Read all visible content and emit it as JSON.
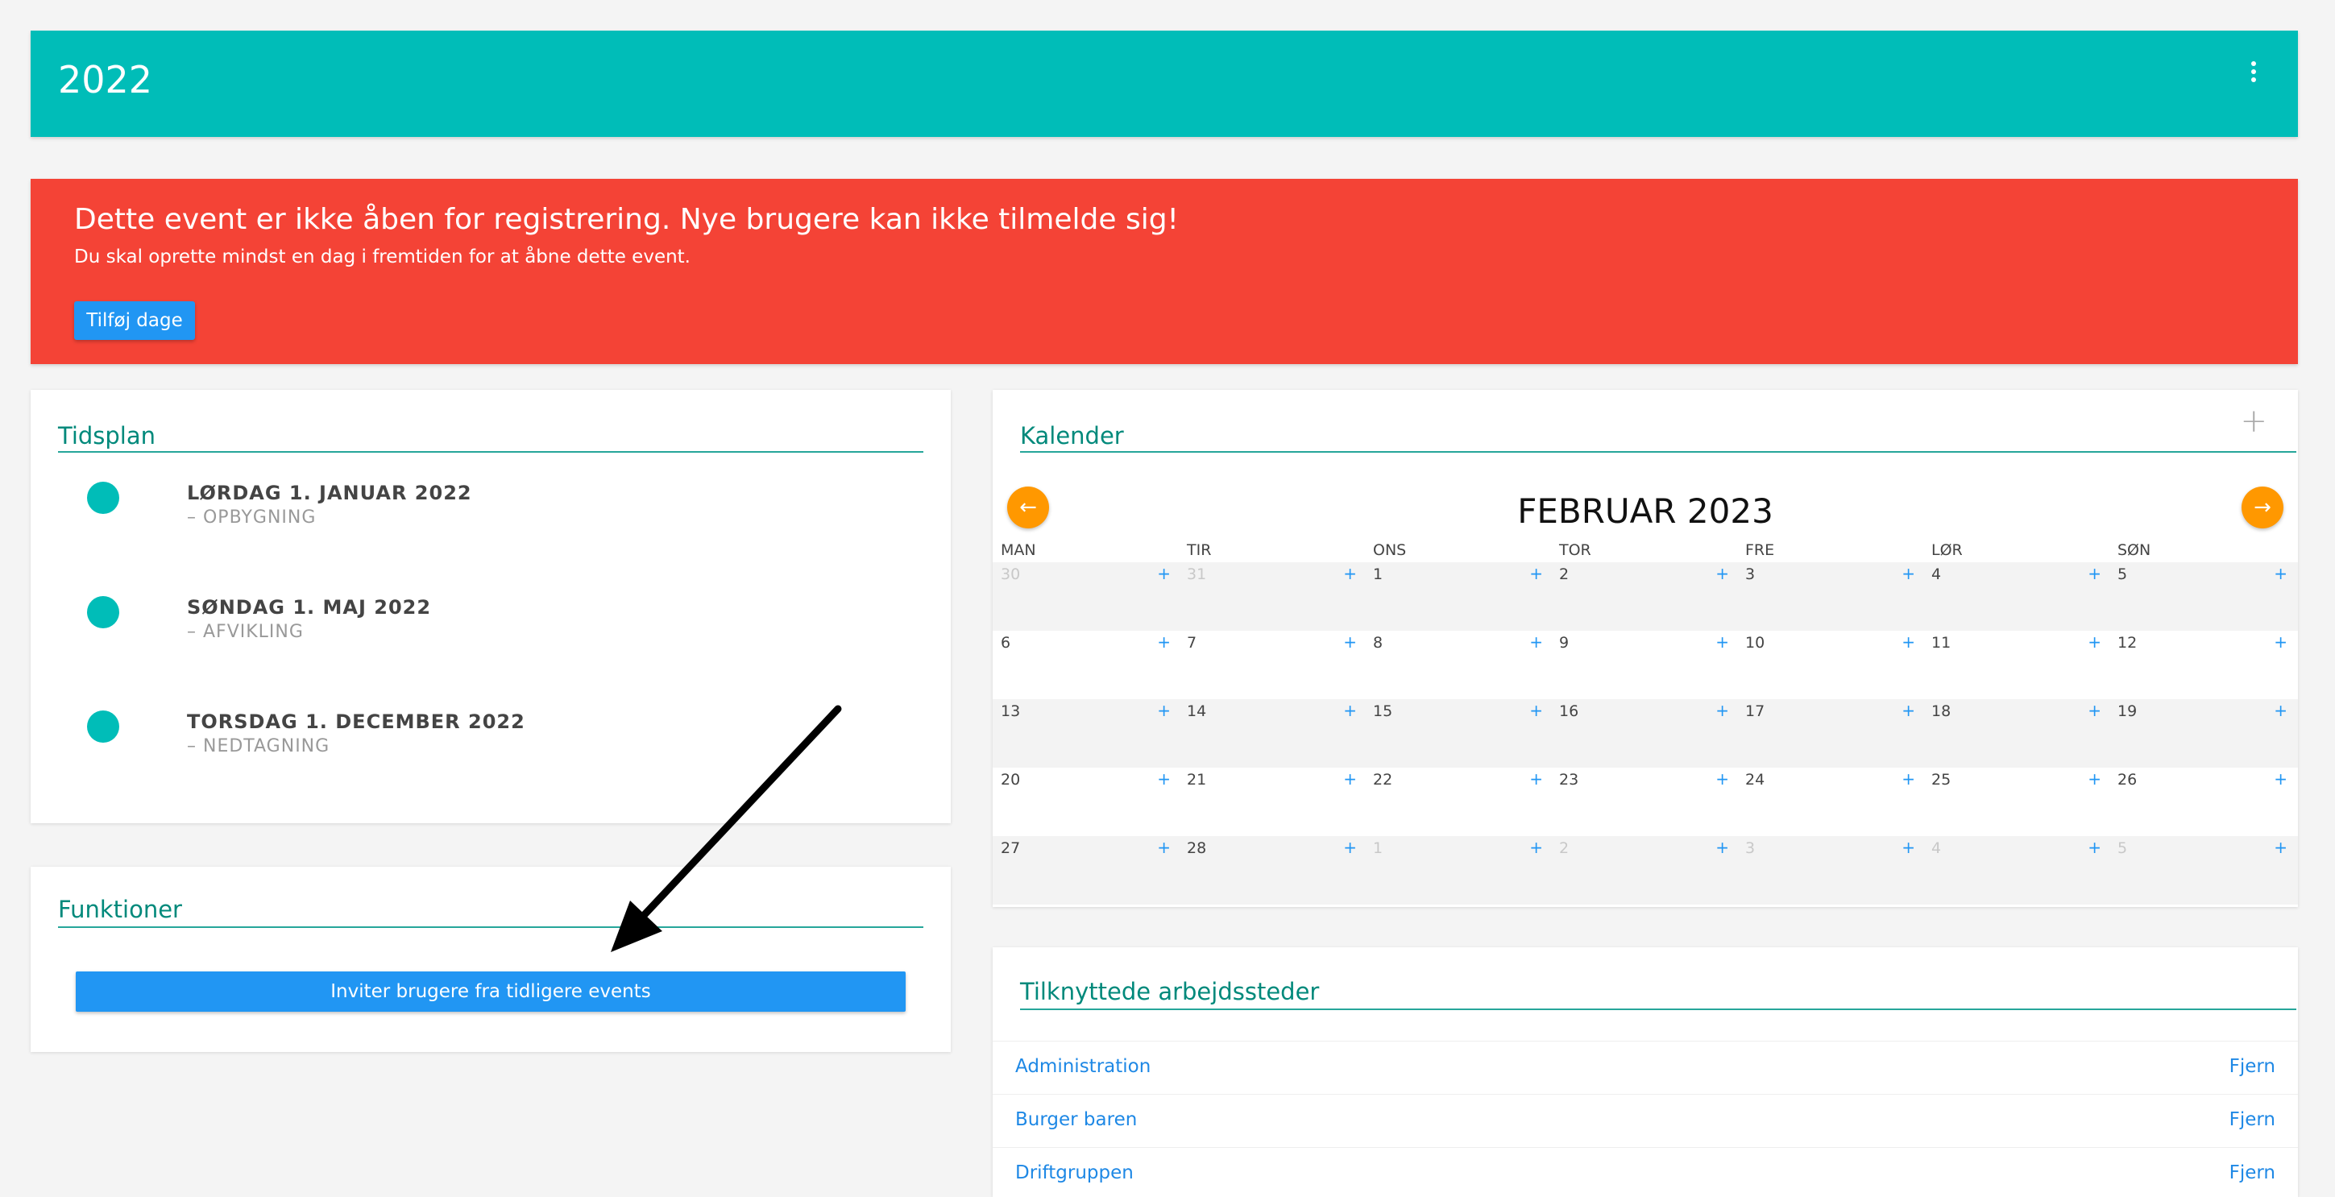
{
  "header": {
    "title": "2022"
  },
  "alert": {
    "title": "Dette event er ikke åben for registrering. Nye brugere kan ikke tilmelde sig!",
    "subtitle": "Du skal oprette mindst en dag i fremtiden for at åbne dette event.",
    "button_label": "Tilføj dage"
  },
  "schedule": {
    "title": "Tidsplan",
    "items": [
      {
        "date": "LØRDAG 1. JANUAR 2022",
        "phase": "–   OPBYGNING"
      },
      {
        "date": "SØNDAG 1. MAJ 2022",
        "phase": "–   AFVIKLING"
      },
      {
        "date": "TORSDAG 1. DECEMBER 2022",
        "phase": "–   NEDTAGNING"
      }
    ]
  },
  "functions": {
    "title": "Funktioner",
    "invite_button": "Inviter brugere fra tidligere events"
  },
  "calendar": {
    "title": "Kalender",
    "add_symbol": "+",
    "month": "FEBRUAR 2023",
    "prev_symbol": "←",
    "next_symbol": "→",
    "weekdays": [
      "MAN",
      "TIR",
      "ONS",
      "TOR",
      "FRE",
      "LØR",
      "SØN"
    ],
    "weeks": [
      [
        "30",
        "31",
        "1",
        "2",
        "3",
        "4",
        "5"
      ],
      [
        "6",
        "7",
        "8",
        "9",
        "10",
        "11",
        "12"
      ],
      [
        "13",
        "14",
        "15",
        "16",
        "17",
        "18",
        "19"
      ],
      [
        "20",
        "21",
        "22",
        "23",
        "24",
        "25",
        "26"
      ],
      [
        "27",
        "28",
        "1",
        "2",
        "3",
        "4",
        "5"
      ]
    ],
    "day_add_symbol": "+"
  },
  "workplaces": {
    "title": "Tilknyttede arbejdssteder",
    "remove_label": "Fjern",
    "items": [
      "Administration",
      "Burger baren",
      "Driftgruppen"
    ]
  }
}
